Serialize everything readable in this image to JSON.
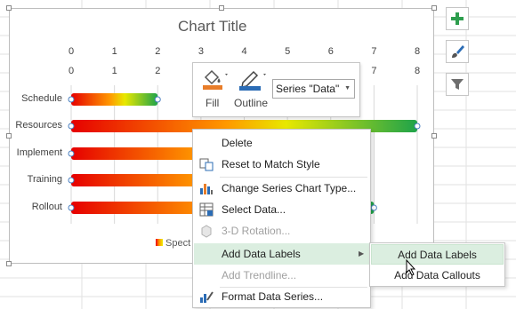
{
  "chart_data": {
    "type": "bar",
    "title": "Chart Title",
    "categories": [
      "Schedule",
      "Resources",
      "Implement",
      "Training",
      "Rollout"
    ],
    "series": [
      {
        "name": "Spect",
        "values": [
          2,
          8,
          6.5,
          6.5,
          7
        ]
      }
    ],
    "x_ticks_primary": [
      "0",
      "1",
      "2",
      "3",
      "4",
      "5",
      "6",
      "7",
      "8"
    ],
    "x_ticks_secondary": [
      "0",
      "1",
      "2",
      "3",
      "4",
      "5",
      "6",
      "7",
      "8"
    ],
    "xlim": [
      0,
      8
    ],
    "legend_position": "bottom",
    "gridlines": true
  },
  "side_buttons": [
    {
      "icon": "plus-icon",
      "label": "Chart Elements"
    },
    {
      "icon": "brush-icon",
      "label": "Chart Styles"
    },
    {
      "icon": "filter-icon",
      "label": "Chart Filters"
    }
  ],
  "mini_toolbar": {
    "fill_label": "Fill",
    "outline_label": "Outline",
    "series_value": "Series \"Data\""
  },
  "context_menu": [
    {
      "label": "Delete",
      "icon": "",
      "disabled": false
    },
    {
      "label": "Reset to Match Style",
      "icon": "reset-style-icon",
      "disabled": false
    },
    {
      "label": "Change Series Chart Type...",
      "icon": "bar-chart-icon",
      "disabled": false
    },
    {
      "label": "Select Data...",
      "icon": "table-icon",
      "disabled": false
    },
    {
      "label": "3-D Rotation...",
      "icon": "cube-icon",
      "disabled": true
    },
    {
      "label": "Add Data Labels",
      "icon": "",
      "disabled": false,
      "submenu": true
    },
    {
      "label": "Add Trendline...",
      "icon": "",
      "disabled": true
    },
    {
      "label": "Format Data Series...",
      "icon": "format-series-icon",
      "disabled": false
    }
  ],
  "submenu": [
    {
      "label": "Add Data Labels"
    },
    {
      "label": "Add Data Callouts"
    }
  ],
  "colors": {
    "gradient_start": "#e60000",
    "gradient_mid": "#ffcc00",
    "gradient_end": "#1ea34a",
    "highlight": "#dbeee0",
    "accent_green": "#2e9e4e"
  }
}
